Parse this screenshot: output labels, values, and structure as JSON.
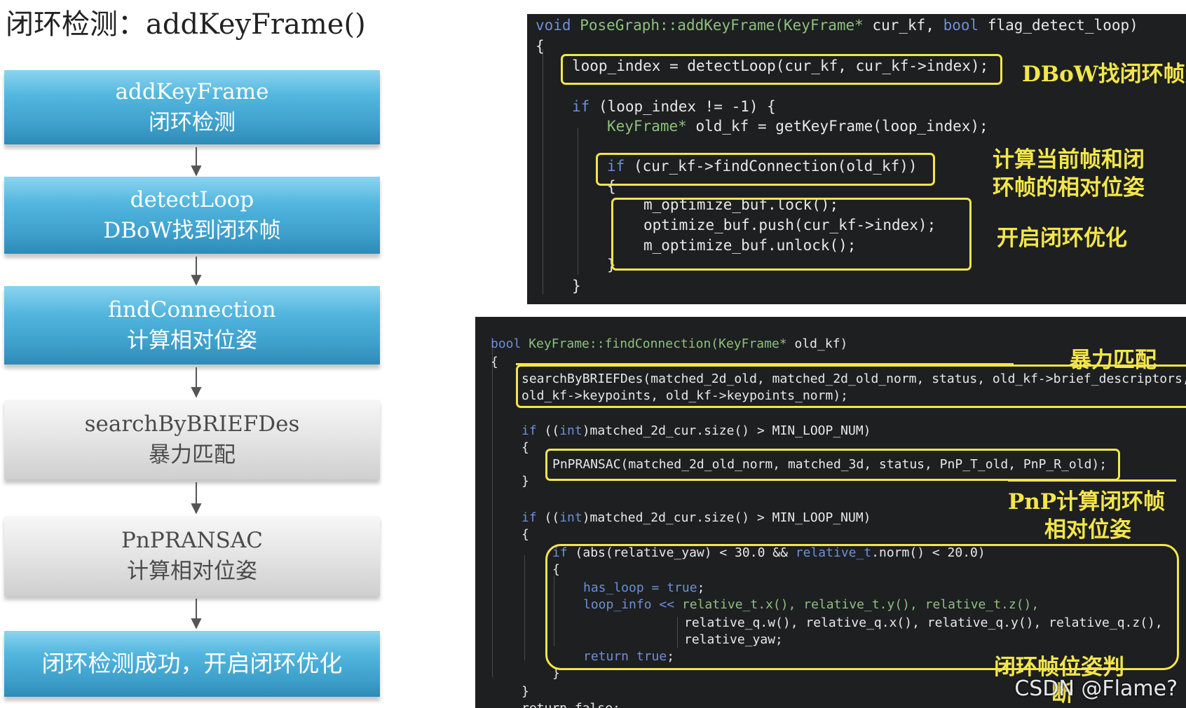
{
  "title": "闭环检测：addKeyFrame()",
  "flow": [
    {
      "line1": "addKeyFrame",
      "line2": "闭环检测"
    },
    {
      "line1": "detectLoop",
      "line2": "DBoW找到闭环帧"
    },
    {
      "line1": "findConnection",
      "line2": "计算相对位姿"
    },
    {
      "line1": "searchByBRIEFDes",
      "line2": "暴力匹配"
    },
    {
      "line1": "PnPRANSAC",
      "line2": "计算相对位姿"
    },
    {
      "line1": "闭环检测成功，开启闭环优化"
    }
  ],
  "panel1": {
    "code": {
      "l1_a": "void",
      "l1_b": " PoseGraph::addKeyFrame(",
      "l1_c": "KeyFrame*",
      "l1_d": " cur_kf, ",
      "l1_e": "bool",
      "l1_f": " flag_detect_loop)",
      "l2": "{",
      "l3": "loop_index = detectLoop(cur_kf, cur_kf->index);",
      "l4_a": "if",
      "l4_b": " (loop_index != -1) {",
      "l5_a": "KeyFrame*",
      "l5_b": " old_kf = getKeyFrame(loop_index);",
      "l6_a": "if",
      "l6_b": " (cur_kf->findConnection(old_kf))",
      "l7": "{",
      "l8": "m_optimize_buf.lock();",
      "l9": "optimize_buf.push(cur_kf->index);",
      "l10": "m_optimize_buf.unlock();",
      "l11": "}",
      "l12": "}"
    },
    "notes": {
      "dbow": "DBoW找闭环帧",
      "relpose_1": "计算当前帧和闭",
      "relpose_2": "环帧的相对位姿",
      "optimize": "开启闭环优化"
    }
  },
  "panel2": {
    "code": {
      "l1_a": "bool",
      "l1_b": " KeyFrame::findConnection(",
      "l1_c": "KeyFrame*",
      "l1_d": " old_kf)",
      "l2": "{",
      "l3": "searchByBRIEFDes(matched_2d_old, matched_2d_old_norm, status, old_kf->brief_descriptors,",
      "l4": "old_kf->keypoints, old_kf->keypoints_norm);",
      "l5_a": "if",
      "l5_b": " ((",
      "l5_c": "int",
      "l5_d": ")matched_2d_cur.size() > MIN_LOOP_NUM)",
      "l6": "{",
      "l7": "PnPRANSAC(matched_2d_old_norm, matched_3d, status, PnP_T_old, PnP_R_old);",
      "l8": "}",
      "l9_a": "if",
      "l9_b": " ((",
      "l9_c": "int",
      "l9_d": ")matched_2d_cur.size() > MIN_LOOP_NUM)",
      "l10": "{",
      "l11_a": "if",
      "l11_b": " (abs(relative_yaw) < 30.0 && ",
      "l11_c": "relative_t",
      "l11_d": ".norm() < 20.0)",
      "l12": "{",
      "l13_a": "has_loop = ",
      "l13_b": "true",
      "l14_a": "loop_info << ",
      "l14_b": "relative_t.x(), relative_t.y(), relative_t.z(),",
      "l15": "relative_q.w(), relative_q.x(), relative_q.y(), relative_q.z(),",
      "l16": "relative_yaw;",
      "l17_a": "return ",
      "l17_b": "true",
      "l18": "}",
      "l19": "}",
      "l20": "return false;"
    },
    "notes": {
      "brute": "暴力匹配",
      "pnp_1": "PnP计算闭环帧",
      "pnp_2": "相对位姿",
      "judge_1": "闭环帧位姿判",
      "judge_2": "断"
    }
  },
  "watermark": "CSDN @Flame?",
  "colors": {
    "highlight": "#f3e64a",
    "code_bg": "#1d1f21",
    "keyword": "#6e8fd6",
    "type": "#8ec07c",
    "flow_blue": "#3d9fcb",
    "flow_gray": "#d8d8d8"
  }
}
